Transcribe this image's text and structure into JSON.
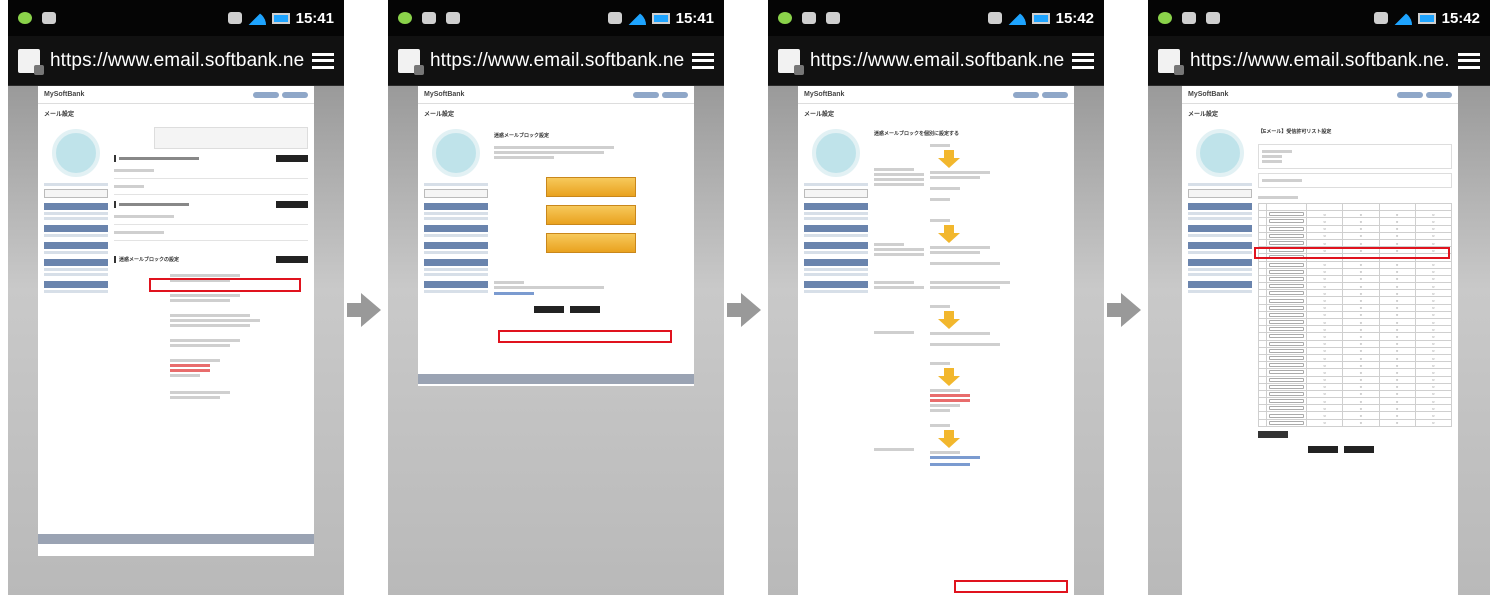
{
  "screens": [
    {
      "time": "15:41",
      "url": "https://www.email.softbank.ne."
    },
    {
      "time": "15:41",
      "url": "https://www.email.softbank.ne."
    },
    {
      "time": "15:42",
      "url": "https://www.email.softbank.ne."
    },
    {
      "time": "15:42",
      "url": "https://www.email.softbank.ne."
    }
  ],
  "webpage": {
    "logo": "MySoftBank",
    "page_title": "メール設定",
    "s1_block_heading": "迷惑メールブロックの設定",
    "s2_block_heading": "迷惑メールブロック設定",
    "s3_heading": "迷惑メールブロックを個別に設定する",
    "s4_heading": "【Eメール】受信許可リスト設定"
  },
  "colors": {
    "highlight": "#e0131e",
    "arrow": "#999999"
  }
}
